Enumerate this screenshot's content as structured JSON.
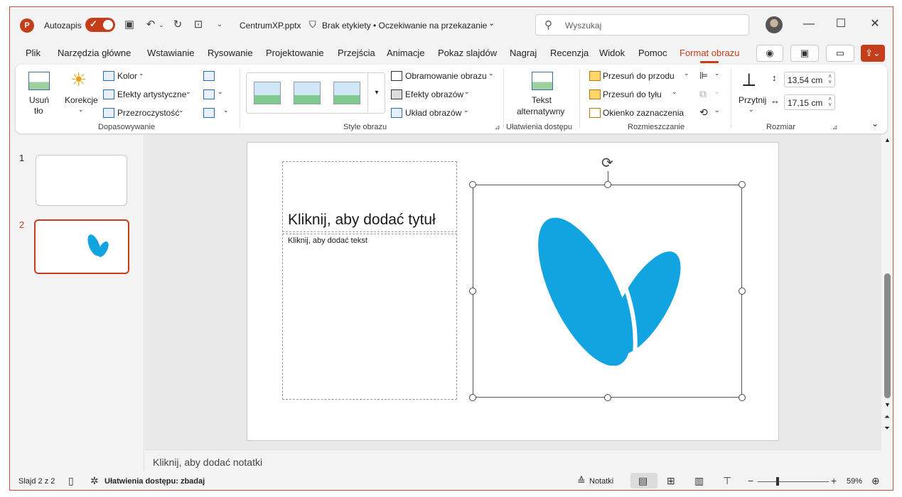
{
  "titlebar": {
    "app_logo": "P",
    "autosave_label": "Autozapis",
    "filename": "CentrumXP.pptx",
    "label_status": "Brak etykiety • Oczekiwanie na przekazanie",
    "search_placeholder": "Wyszukaj",
    "icons": [
      "save-icon",
      "undo-icon",
      "redo-icon",
      "present-icon",
      "customize-icon"
    ]
  },
  "menu": {
    "tabs": [
      "Plik",
      "Narzędzia główne",
      "Wstawianie",
      "Rysowanie",
      "Projektowanie",
      "Przejścia",
      "Animacje",
      "Pokaz slajdów",
      "Nagraj",
      "Recenzja",
      "Widok",
      "Pomoc",
      "Format obrazu"
    ],
    "active_tab": "Format obrazu"
  },
  "ribbon": {
    "adjust": {
      "remove_bg_1": "Usuń",
      "remove_bg_2": "tło",
      "corrections": "Korekcje",
      "color": "Kolor",
      "artistic": "Efekty artystyczne",
      "transparency": "Przezroczystość",
      "group": "Dopasowywanie"
    },
    "styles": {
      "border": "Obramowanie obrazu",
      "effects": "Efekty obrazów",
      "layout": "Układ obrazów",
      "group": "Style obrazu"
    },
    "accessibility": {
      "alt_text_1": "Tekst",
      "alt_text_2": "alternatywny",
      "group": "Ułatwienia dostępu"
    },
    "arrange": {
      "bring_forward": "Przesuń do przodu",
      "send_backward": "Przesuń do tyłu",
      "selection_pane": "Okienko zaznaczenia",
      "group": "Rozmieszczanie"
    },
    "size": {
      "crop": "Przytnij",
      "height": "13,54 cm",
      "width": "17,15 cm",
      "group": "Rozmiar"
    }
  },
  "slides_panel": {
    "slide_numbers": [
      "1",
      "2"
    ],
    "selected": 2
  },
  "slide": {
    "title_placeholder": "Kliknij, aby dodać tytuł",
    "body_placeholder": "Kliknij, aby dodać tekst",
    "logo_color": "#12a3e1"
  },
  "notes_placeholder": "Kliknij, aby dodać notatki",
  "status": {
    "slide_counter": "Slajd 2 z 2",
    "accessibility": "Ułatwienia dostępu: zbadaj",
    "notes": "Notatki",
    "zoom": "59%"
  },
  "colors": {
    "accent": "#c43e1c"
  }
}
